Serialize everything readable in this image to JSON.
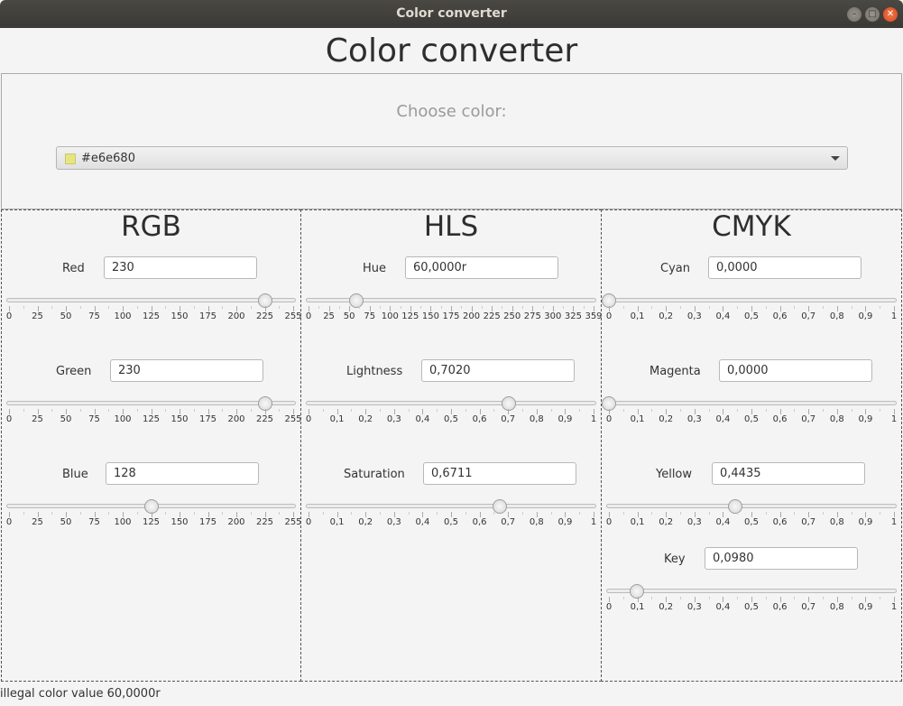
{
  "window": {
    "title": "Color converter"
  },
  "app": {
    "title": "Color converter"
  },
  "chooser": {
    "label": "Choose color:",
    "value": "#e6e680",
    "swatch": "#e6e680"
  },
  "rgb": {
    "title": "RGB",
    "rows": [
      {
        "label": "Red",
        "value": "230",
        "level": 230,
        "max": 255
      },
      {
        "label": "Green",
        "value": "230",
        "level": 230,
        "max": 255
      },
      {
        "label": "Blue",
        "value": "128",
        "level": 128,
        "max": 255
      }
    ],
    "ticks": [
      "0",
      "25",
      "50",
      "75",
      "100",
      "125",
      "150",
      "175",
      "200",
      "225",
      "255"
    ]
  },
  "hls": {
    "title": "HLS",
    "rows": [
      {
        "label": "Hue",
        "value": "60,0000r",
        "level": 60,
        "max": 359
      },
      {
        "label": "Lightness",
        "value": "0,7020",
        "level": 0.702,
        "max": 1
      },
      {
        "label": "Saturation",
        "value": "0,6711",
        "level": 0.6711,
        "max": 1
      }
    ],
    "hue_ticks": [
      "0",
      "25",
      "50",
      "75",
      "100",
      "125",
      "150",
      "175",
      "200",
      "225",
      "250",
      "275",
      "300",
      "325",
      "359"
    ],
    "unit_ticks": [
      "0",
      "0,1",
      "0,2",
      "0,3",
      "0,4",
      "0,5",
      "0,6",
      "0,7",
      "0,8",
      "0,9",
      "1"
    ]
  },
  "cmyk": {
    "title": "CMYK",
    "rows": [
      {
        "label": "Cyan",
        "value": "0,0000",
        "level": 0,
        "max": 1
      },
      {
        "label": "Magenta",
        "value": "0,0000",
        "level": 0,
        "max": 1
      },
      {
        "label": "Yellow",
        "value": "0,4435",
        "level": 0.4435,
        "max": 1
      },
      {
        "label": "Key",
        "value": "0,0980",
        "level": 0.098,
        "max": 1
      }
    ],
    "ticks": [
      "0",
      "0,1",
      "0,2",
      "0,3",
      "0,4",
      "0,5",
      "0,6",
      "0,7",
      "0,8",
      "0,9",
      "1"
    ]
  },
  "status": {
    "text": "illegal color value 60,0000r"
  }
}
